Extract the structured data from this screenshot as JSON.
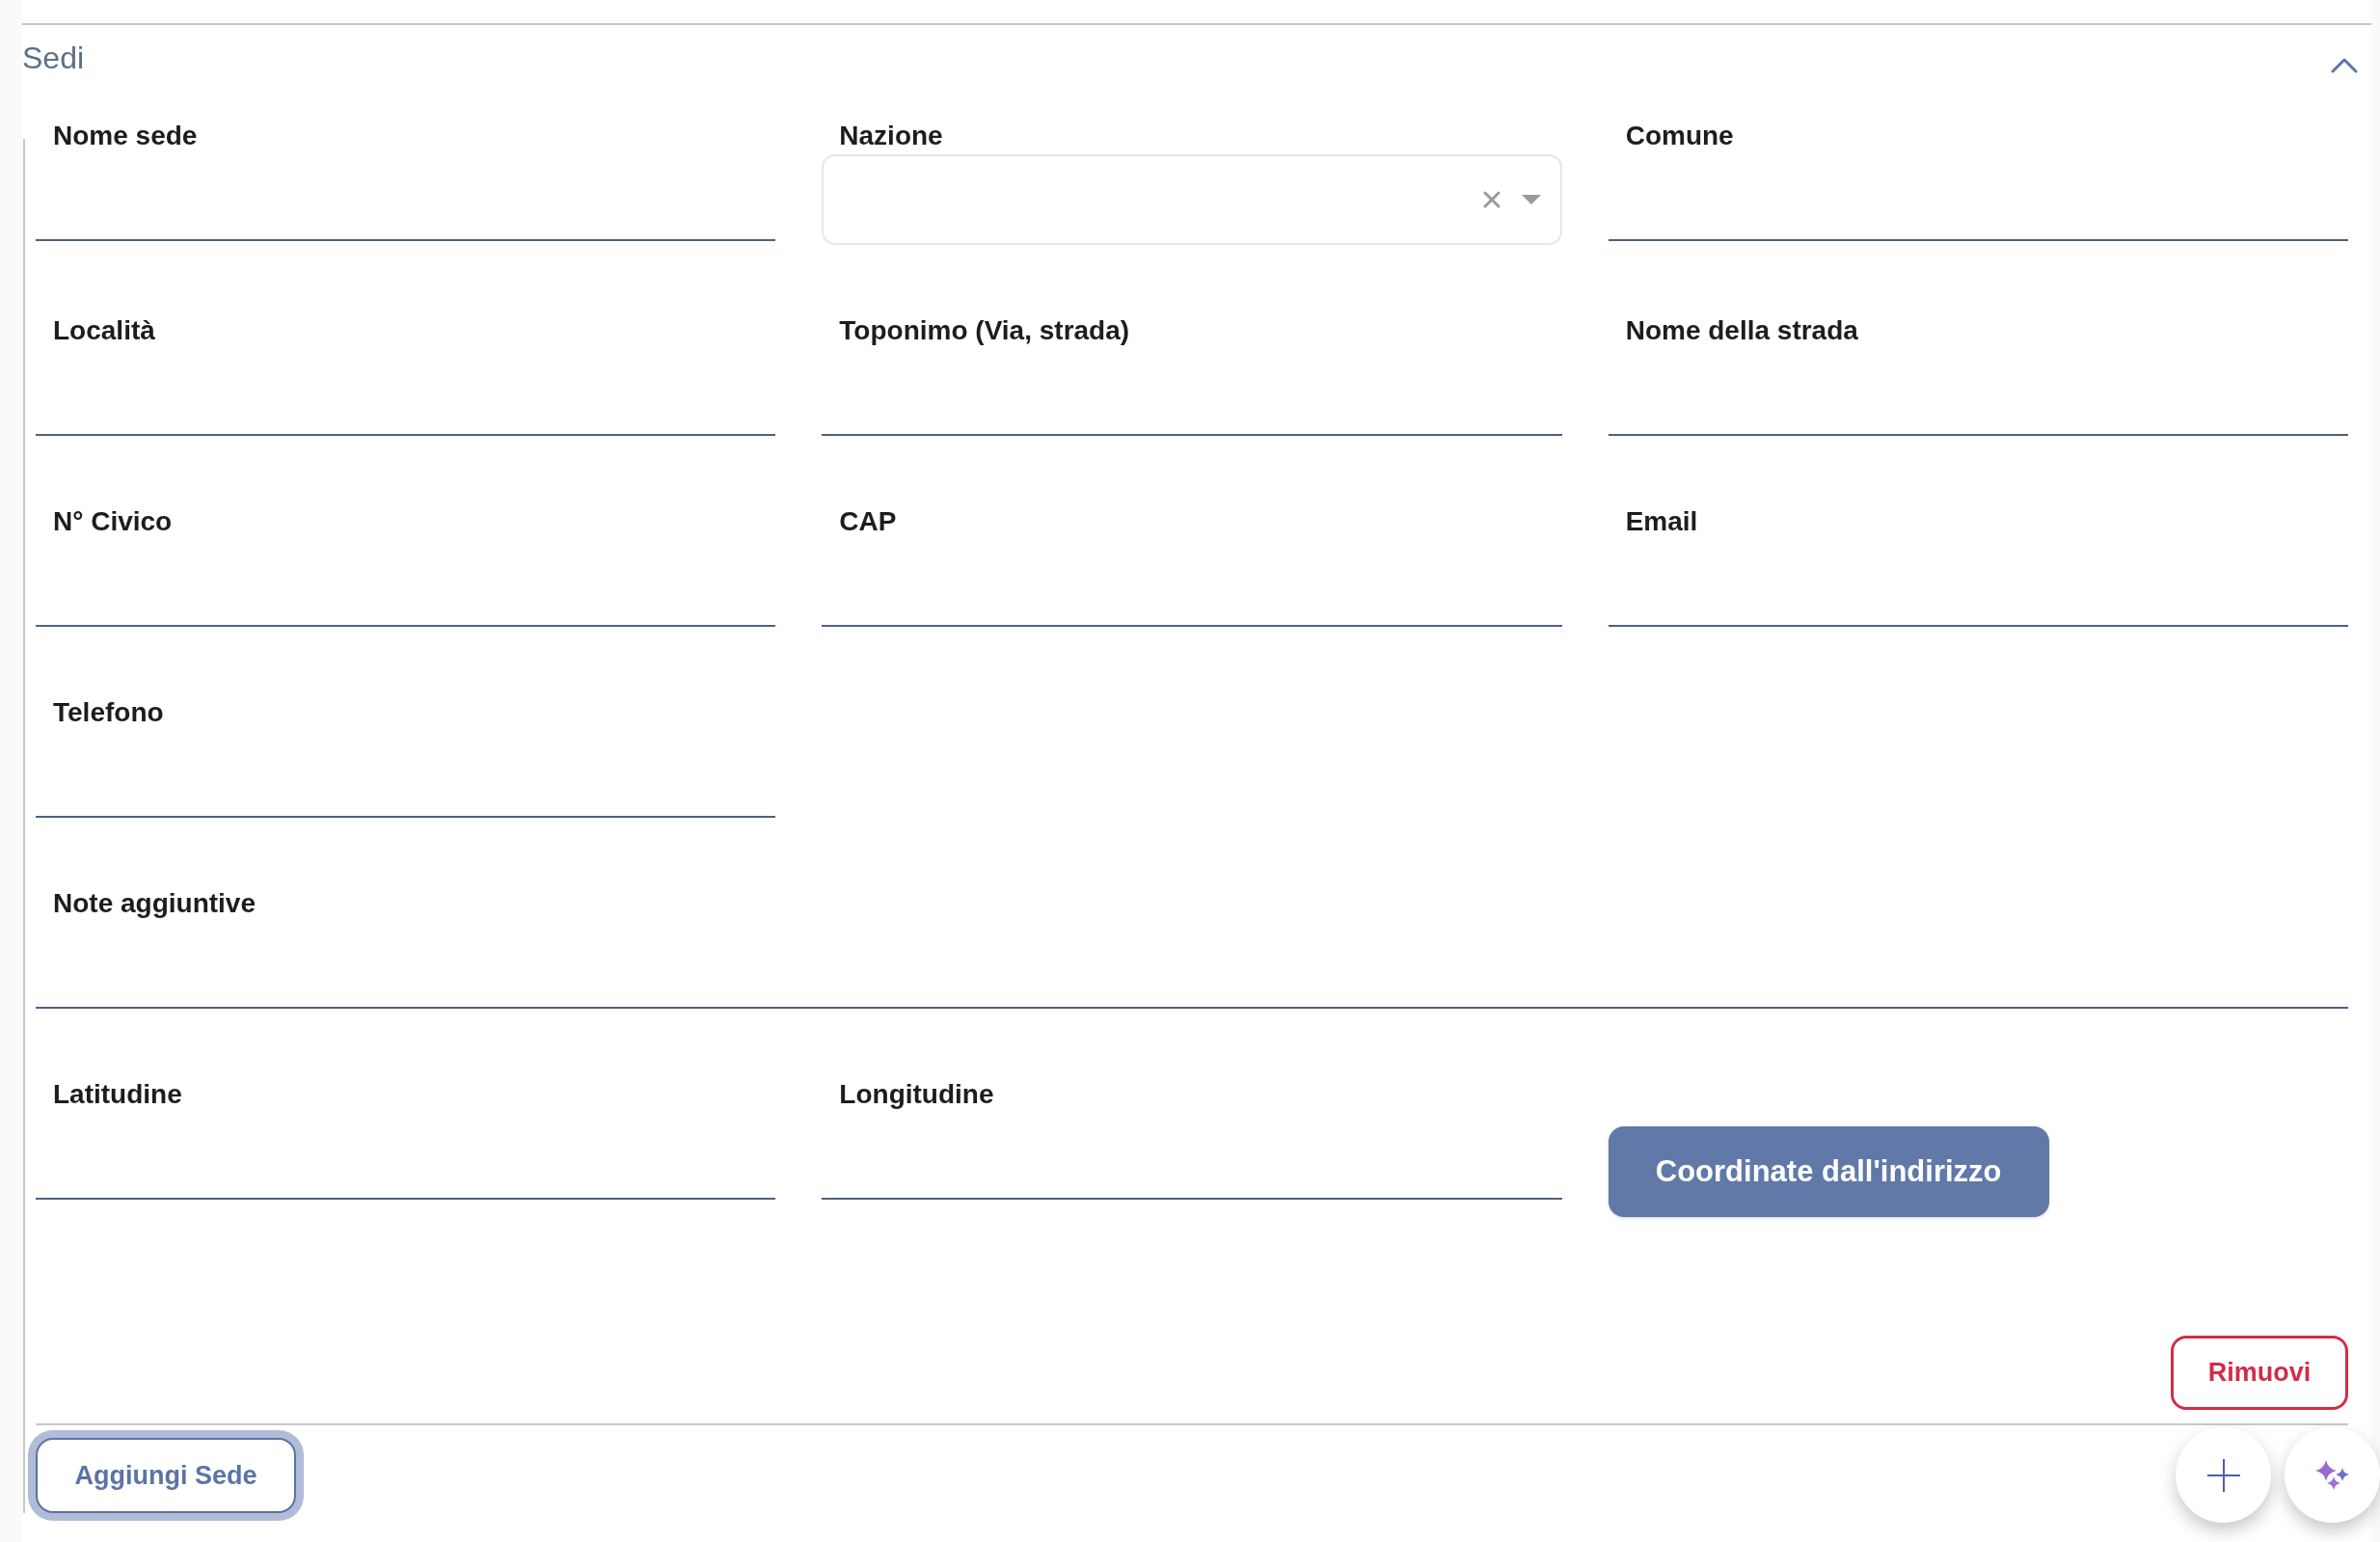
{
  "section": {
    "title": "Sedi",
    "expanded": true,
    "rows": [
      {
        "items": [
          {
            "kind": "text",
            "label": "Nome sede"
          },
          {
            "kind": "select",
            "label": "Nazione"
          },
          {
            "kind": "text",
            "label": "Comune"
          }
        ]
      },
      {
        "items": [
          {
            "kind": "text",
            "label": "Località"
          },
          {
            "kind": "text",
            "label": "Toponimo (Via, strada)"
          },
          {
            "kind": "text",
            "label": "Nome della strada"
          }
        ]
      },
      {
        "items": [
          {
            "kind": "text",
            "label": "N° Civico"
          },
          {
            "kind": "text",
            "label": "CAP"
          },
          {
            "kind": "text",
            "label": "Email"
          }
        ]
      },
      {
        "items": [
          {
            "kind": "text",
            "label": "Telefono"
          }
        ]
      },
      {
        "items": [
          {
            "kind": "textarea",
            "label": "Note aggiuntive"
          }
        ]
      },
      {
        "items": [
          {
            "kind": "text",
            "label": "Latitudine"
          },
          {
            "kind": "text",
            "label": "Longitudine"
          },
          {
            "kind": "button",
            "label": "Coordinate dall'indirizzo"
          }
        ]
      }
    ],
    "remove_button": {
      "label": "Rimuovi"
    },
    "add_button": {
      "label": "Aggiungi Sede",
      "focused": true
    }
  },
  "floating_buttons": [
    {
      "kind": "add"
    },
    {
      "kind": "sparkle"
    }
  ]
}
